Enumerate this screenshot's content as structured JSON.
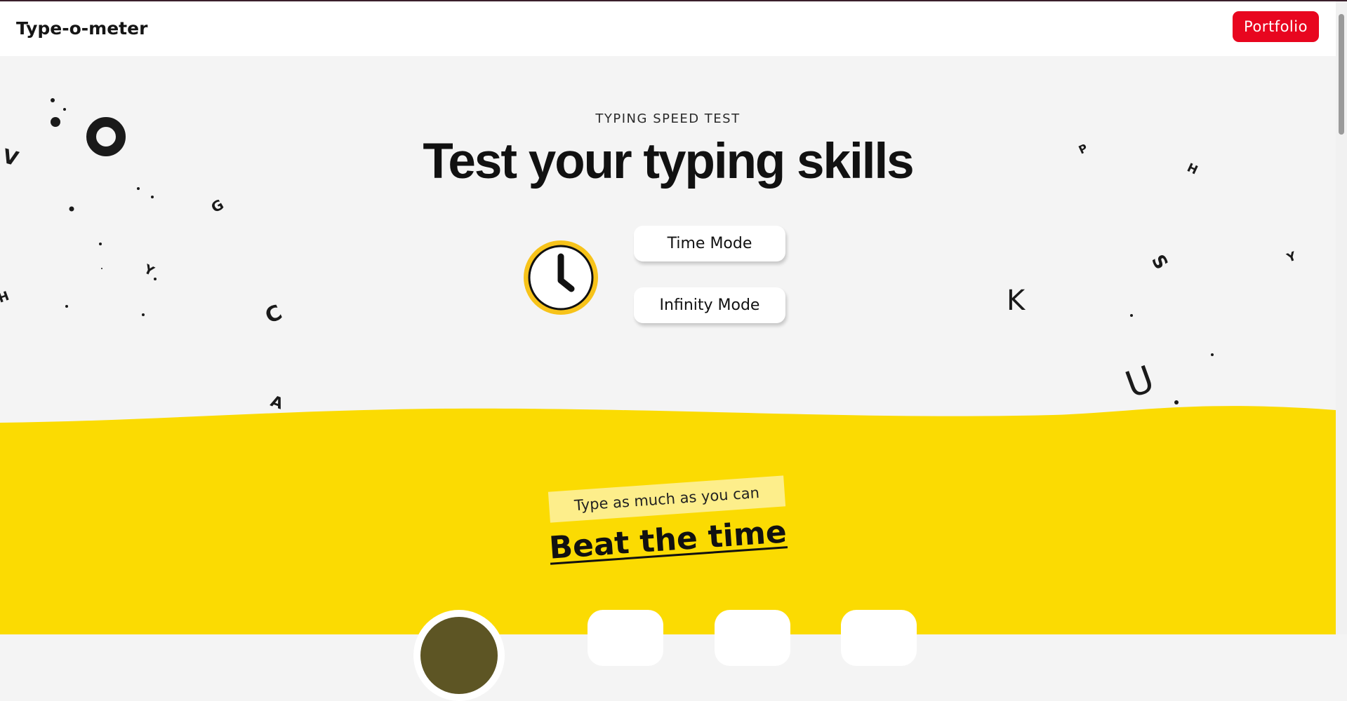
{
  "header": {
    "brand": "Type-o-meter",
    "portfolio_label": "Portfolio"
  },
  "hero": {
    "eyebrow": "TYPING SPEED TEST",
    "headline": "Test your typing skills",
    "clock_icon": "clock-icon",
    "modes": [
      {
        "label": "Time Mode"
      },
      {
        "label": "Infinity Mode"
      }
    ],
    "decorative_letters": [
      "V",
      "G",
      "Y",
      "H",
      "C",
      "A",
      "P",
      "H",
      "S",
      "Y",
      "K",
      "U"
    ]
  },
  "section": {
    "tagline": "Type as much as you can",
    "title": "Beat the time"
  },
  "colors": {
    "brand_red": "#e8061f",
    "accent_yellow": "#fbdb02",
    "highlight_yellow": "#fdee8b",
    "clock_ring": "#f7c31a",
    "background": "#f4f4f4"
  }
}
